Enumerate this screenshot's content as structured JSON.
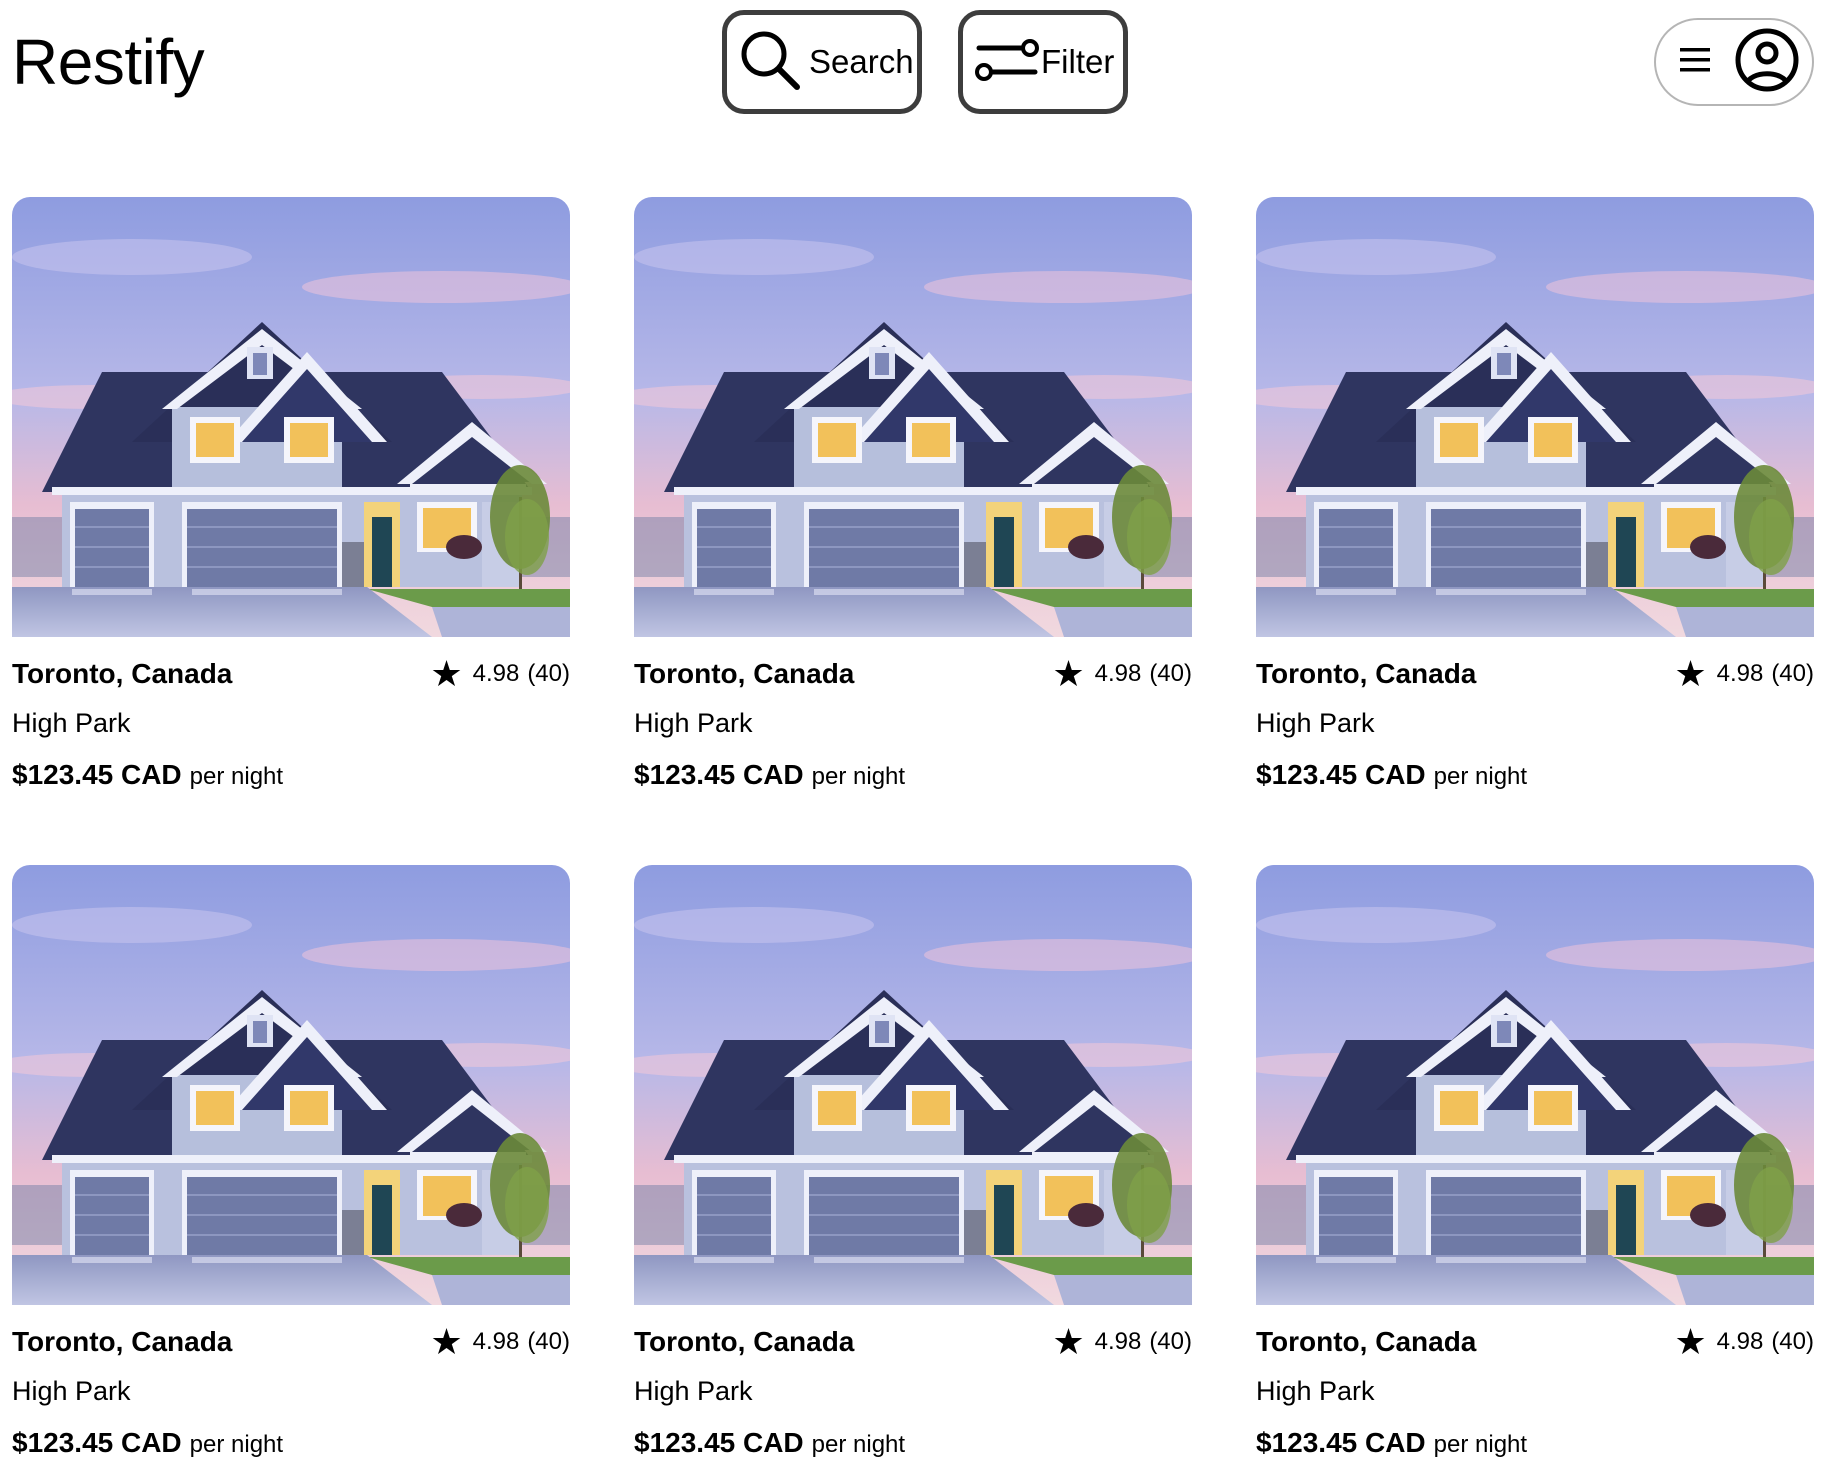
{
  "header": {
    "brand": "Restify",
    "search_label": "Search",
    "filter_label": "Filter"
  },
  "icons": {
    "search": "search-icon",
    "filter": "sliders-icon",
    "menu": "hamburger-menu-icon",
    "account": "user-circle-icon",
    "rating": "star-icon"
  },
  "colors": {
    "button_border": "#3d3d3d",
    "pill_border": "#b5b5b5",
    "roof": "#2f3560",
    "siding": "#b6bfdc",
    "sky_top": "#9aa7e0",
    "sky_pink": "#e8b9cf",
    "window_light": "#f2c15a"
  },
  "listings": [
    {
      "city": "Toronto, Canada",
      "rating_star": "★",
      "rating": "4.98",
      "reviews": "(40)",
      "neighborhood": "High Park",
      "price": "$123.45 CAD",
      "unit": "per night"
    },
    {
      "city": "Toronto, Canada",
      "rating_star": "★",
      "rating": "4.98",
      "reviews": "(40)",
      "neighborhood": "High Park",
      "price": "$123.45 CAD",
      "unit": "per night"
    },
    {
      "city": "Toronto, Canada",
      "rating_star": "★",
      "rating": "4.98",
      "reviews": "(40)",
      "neighborhood": "High Park",
      "price": "$123.45 CAD",
      "unit": "per night"
    },
    {
      "city": "Toronto, Canada",
      "rating_star": "★",
      "rating": "4.98",
      "reviews": "(40)",
      "neighborhood": "High Park",
      "price": "$123.45 CAD",
      "unit": "per night"
    },
    {
      "city": "Toronto, Canada",
      "rating_star": "★",
      "rating": "4.98",
      "reviews": "(40)",
      "neighborhood": "High Park",
      "price": "$123.45 CAD",
      "unit": "per night"
    },
    {
      "city": "Toronto, Canada",
      "rating_star": "★",
      "rating": "4.98",
      "reviews": "(40)",
      "neighborhood": "High Park",
      "price": "$123.45 CAD",
      "unit": "per night"
    }
  ]
}
